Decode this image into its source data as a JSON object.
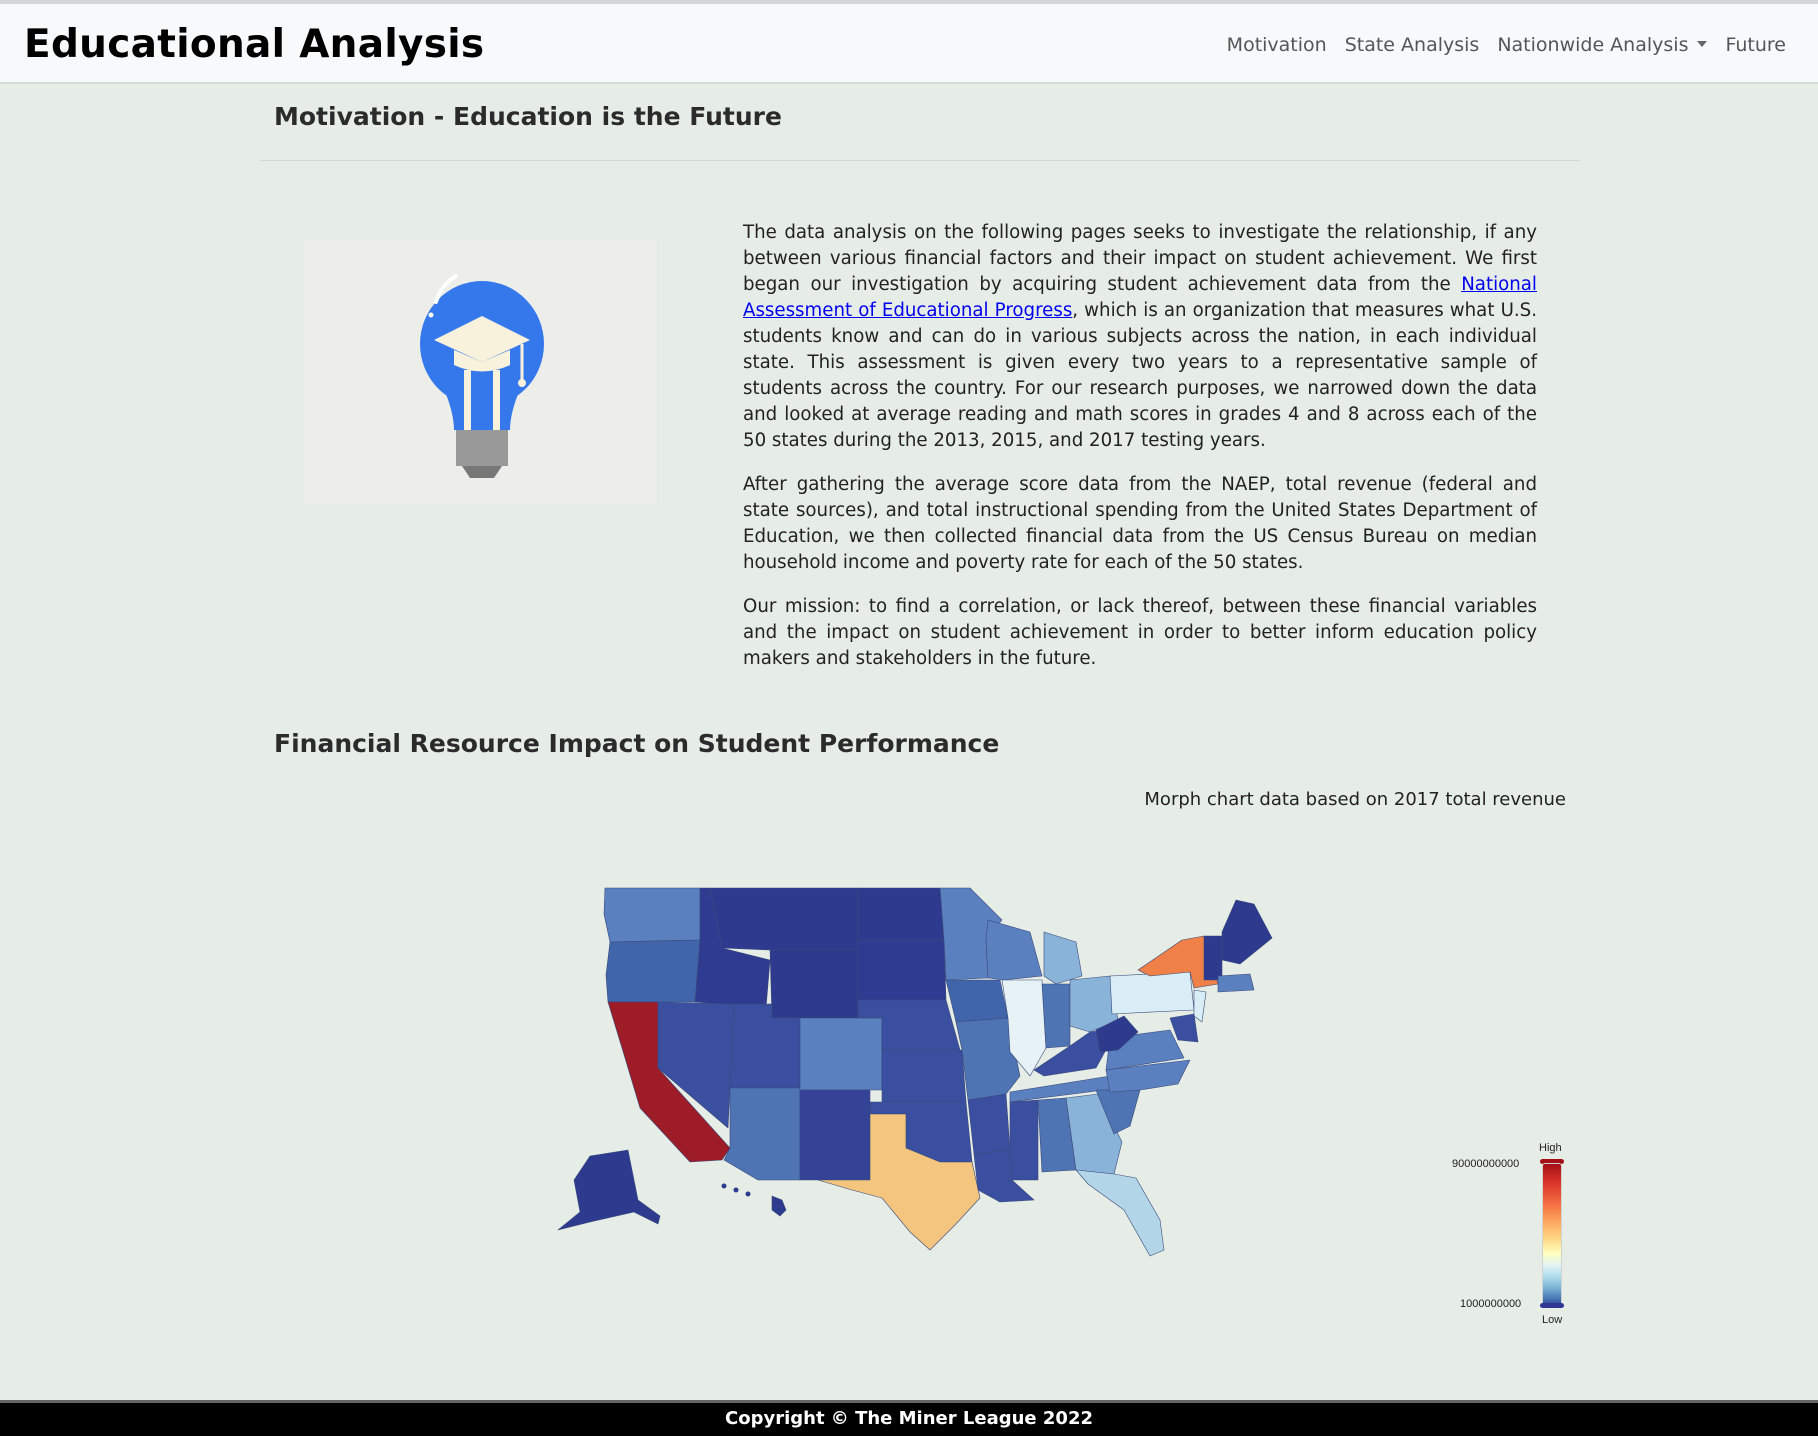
{
  "navbar": {
    "brand": "Educational Analysis",
    "links": [
      "Motivation",
      "State Analysis",
      "Nationwide Analysis",
      "Future"
    ]
  },
  "motivation": {
    "title": "Motivation - Education is the Future",
    "p1_before_link": "The data analysis on the following pages seeks to investigate the relationship, if any between various financial factors and their impact on student achievement. We first began our investigation by acquiring student achievement data from the ",
    "p1_link": "National Assessment of Educational Progress",
    "p1_after_link": ", which is an organization that measures what U.S. students know and can do in various subjects across the nation, in each individual state. This assessment is given every two years to a representative sample of students across the country. For our research purposes, we narrowed down the data and looked at average reading and math scores in grades 4 and 8 across each of the 50 states during the 2013, 2015, and 2017 testing years.",
    "p2": "After gathering the average score data from the NAEP, total revenue (federal and state sources), and total instructional spending from the United States Department of Education, we then collected financial data from the US Census Bureau on median household income and poverty rate for each of the 50 states.",
    "p3": "Our mission: to find a correlation, or lack thereof, between these financial variables and the impact on student achievement in order to better inform education policy makers and stakeholders in the future."
  },
  "financial": {
    "title": "Financial Resource Impact on Student Performance",
    "caption": "Morph chart data based on 2017 total revenue"
  },
  "map_legend": {
    "high_label": "High",
    "low_label": "Low",
    "max_value": "90000000000",
    "min_value": "1000000000",
    "high_color": "#a50f15",
    "low_color": "#313695"
  },
  "map_colors": {
    "western": "#4e74b4",
    "mountain": "#2d3a8e",
    "plains": "#3a4fa0",
    "california": "#9e1b28",
    "texas": "#f4c57e",
    "new_york": "#ef8048",
    "pennsylvania": "#d8edf5",
    "illinois": "#e6f2f6",
    "florida": "#b2d6e8",
    "midwest_light": "#8ab3d9",
    "southeast": "#5a80c0"
  },
  "footer": {
    "text": "Copyright © The Miner League 2022"
  }
}
